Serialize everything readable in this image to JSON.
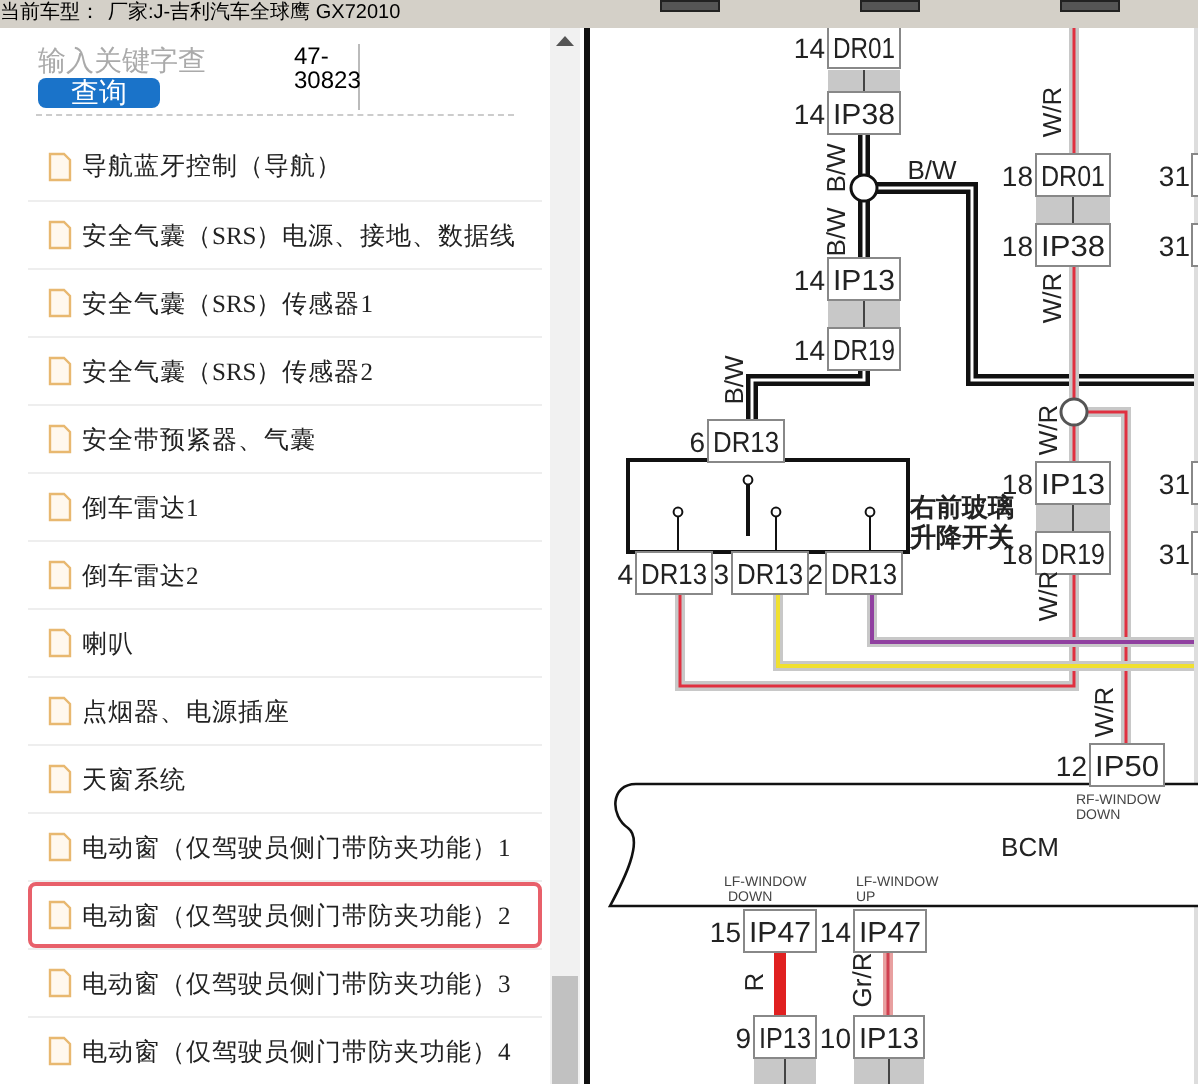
{
  "header": {
    "vehicle_label": "当前车型：",
    "vehicle": "厂家:J-吉利汽车全球鹰 GX72010"
  },
  "search": {
    "placeholder": "输入关键字查",
    "button": "查询",
    "code": "47-30823"
  },
  "list": [
    {
      "label": "导航蓝牙控制（导航）",
      "selected": false
    },
    {
      "label": "安全气囊（SRS）电源、接地、数据线",
      "selected": false
    },
    {
      "label": "安全气囊（SRS）传感器1",
      "selected": false
    },
    {
      "label": "安全气囊（SRS）传感器2",
      "selected": false
    },
    {
      "label": "安全带预紧器、气囊",
      "selected": false
    },
    {
      "label": "倒车雷达1",
      "selected": false
    },
    {
      "label": "倒车雷达2",
      "selected": false
    },
    {
      "label": "喇叭",
      "selected": false
    },
    {
      "label": "点烟器、电源插座",
      "selected": false
    },
    {
      "label": "天窗系统",
      "selected": false
    },
    {
      "label": "电动窗（仅驾驶员侧门带防夹功能）1",
      "selected": false
    },
    {
      "label": "电动窗（仅驾驶员侧门带防夹功能）2",
      "selected": true
    },
    {
      "label": "电动窗（仅驾驶员侧门带防夹功能）3",
      "selected": false
    },
    {
      "label": "电动窗（仅驾驶员侧门带防夹功能）4",
      "selected": false
    }
  ],
  "diagram": {
    "connectors": [
      {
        "pin": "14",
        "code": "DR01"
      },
      {
        "pin": "14",
        "code": "IP38"
      },
      {
        "pin": "14",
        "code": "IP13"
      },
      {
        "pin": "14",
        "code": "DR19"
      },
      {
        "pin": "18",
        "code": "DR01"
      },
      {
        "pin": "18",
        "code": "IP38"
      },
      {
        "pin": "6",
        "code": "DR13"
      },
      {
        "pin": "4",
        "code": "DR13"
      },
      {
        "pin": "3",
        "code": "DR13"
      },
      {
        "pin": "2",
        "code": "DR13"
      },
      {
        "pin": "18",
        "code": "IP13"
      },
      {
        "pin": "18",
        "code": "DR19"
      },
      {
        "pin": "12",
        "code": "IP50"
      },
      {
        "pin": "15",
        "code": "IP47"
      },
      {
        "pin": "14",
        "code": "IP47"
      },
      {
        "pin": "9",
        "code": "IP13"
      },
      {
        "pin": "10",
        "code": "IP13"
      }
    ],
    "edge_pins": [
      "31",
      "31",
      "31",
      "31"
    ],
    "wire_labels": [
      "B/W",
      "B/W",
      "B/W",
      "B/W",
      "W/R",
      "W/R",
      "W/R",
      "W/R",
      "W/R",
      "R",
      "Gr/R"
    ],
    "switch_note": [
      "右前玻璃",
      "升降开关"
    ],
    "module": "BCM",
    "signal_labels": [
      {
        "lines": [
          "RF-WINDOW",
          "DOWN"
        ]
      },
      {
        "lines": [
          "LF-WINDOW",
          "DOWN"
        ]
      },
      {
        "lines": [
          "LF-WINDOW",
          "UP"
        ]
      }
    ]
  }
}
